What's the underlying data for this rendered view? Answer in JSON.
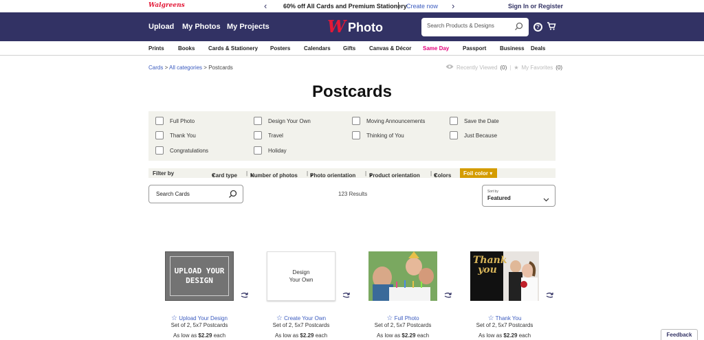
{
  "promo": {
    "brand": "Walgreens",
    "message": "60% off All Cards and Premium Stationery",
    "separator": "|",
    "create_link": "Create now",
    "signin": "Sign In or Register"
  },
  "header": {
    "upload": "Upload",
    "my_photos": "My Photos",
    "my_projects": "My Projects",
    "logo_text": "Photo",
    "search_placeholder": "Search Products & Designs"
  },
  "catnav": [
    "Prints",
    "Books",
    "Cards & Stationery",
    "Posters",
    "Calendars",
    "Gifts",
    "Canvas & Décor",
    "Same Day",
    "Passport",
    "Business",
    "Deals"
  ],
  "breadcrumb": {
    "cards": "Cards",
    "all_categories": "All categories",
    "current": "Postcards",
    "sep": ">"
  },
  "recent": {
    "recently_viewed": "Recently Viewed",
    "recently_count": "(0)",
    "favorites": "My Favorites",
    "favorites_count": "(0)"
  },
  "page_title": "Postcards",
  "filters": [
    "Full Photo",
    "Design Your Own",
    "Moving Announcements",
    "Save the Date",
    "Thank You",
    "Travel",
    "Thinking of You",
    "Just Because",
    "Congratulations",
    "Holiday"
  ],
  "filterbar": {
    "label": "Filter by",
    "card_type": "Card type",
    "num_photos": "Number of photos",
    "photo_orientation": "Photo orientation",
    "product_orientation": "Product orientation",
    "colors": "Colors",
    "foil_color": "Foil color"
  },
  "search_cards": {
    "placeholder": "Search Cards"
  },
  "results": "123 Results",
  "sort": {
    "label": "Sort by",
    "value": "Featured"
  },
  "products": [
    {
      "name": "Upload Your Design",
      "thumb_text": "UPLOAD YOUR DESIGN",
      "set": "Set of 2, 5x7 Postcards",
      "price_prefix": "As low as",
      "price": "$2.29",
      "price_suffix": "each"
    },
    {
      "name": "Create Your Own",
      "thumb_text": "Design Your Own",
      "set": "Set of 2, 5x7 Postcards",
      "price_prefix": "As low as",
      "price": "$2.29",
      "price_suffix": "each"
    },
    {
      "name": "Full Photo",
      "set": "Set of 2, 5x7 Postcards",
      "price_prefix": "As low as",
      "price": "$2.29",
      "price_suffix": "each"
    },
    {
      "name": "Thank You",
      "thumb_text": "Thank you",
      "set": "Set of 2, 5x7 Postcards",
      "price_prefix": "As low as",
      "price": "$2.29",
      "price_suffix": "each"
    }
  ],
  "feedback": "Feedback",
  "colors": {
    "header_bg": "#323264",
    "brand_red": "#e31837",
    "link": "#3b5bbf",
    "same_day": "#e3007b",
    "foil": "#d49c00",
    "filter_bg": "#f2f2ec"
  }
}
